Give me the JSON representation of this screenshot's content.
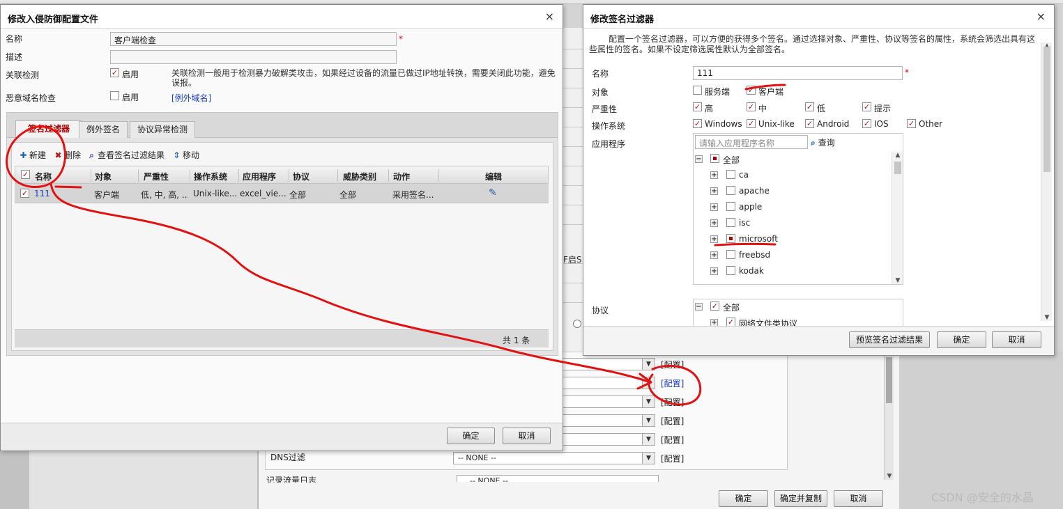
{
  "colors": {
    "annotation_red": "#e01212",
    "link_blue": "#1a3fb8",
    "tab_active_red": "#b00000"
  },
  "background": {
    "sidebar_snippet": "F启S",
    "config_rows": [
      {
        "value": "",
        "link": "[配置]",
        "highlight": false
      },
      {
        "value": "",
        "link": "[配置]",
        "highlight": true
      },
      {
        "value": "",
        "link": "[配置]",
        "highlight": false
      },
      {
        "value": "",
        "link": "[配置]",
        "highlight": false
      },
      {
        "value": "",
        "link": "[配置]",
        "highlight": false
      },
      {
        "value": "-- NONE --",
        "link": "[配置]",
        "highlight": false
      }
    ],
    "dns_label": "DNS过滤",
    "log_label": "记录流量日志",
    "log_value": "-- NONE --",
    "buttons": {
      "ok": "确定",
      "ok_copy": "确定并复制",
      "cancel": "取消"
    }
  },
  "dialog1": {
    "title": "修改入侵防御配置文件",
    "close": "×",
    "fields": {
      "name_label": "名称",
      "name_value": "客户端检查",
      "required_mark": "*",
      "desc_label": "描述",
      "desc_value": "",
      "assoc_label": "关联检测",
      "assoc_enable": "启用",
      "assoc_desc": "关联检测一般用于检测暴力破解类攻击，如果经过设备的流量已做过IP地址转换，需要关闭此功能，避免误报。",
      "malicious_label": "恶意域名检查",
      "malicious_enable": "启用",
      "exception_domain_link": "[例外域名]"
    },
    "tabs": [
      "签名过滤器",
      "例外签名",
      "协议异常检测"
    ],
    "toolbar": {
      "new": "新建",
      "delete": "删除",
      "view": "查看签名过滤结果",
      "move": "移动"
    },
    "grid": {
      "headers": [
        "名称",
        "对象",
        "严重性",
        "操作系统",
        "应用程序",
        "协议",
        "威胁类别",
        "动作",
        "编辑"
      ],
      "rows": [
        {
          "name": "111",
          "object": "客户端",
          "severity": "低, 中, 高, ...",
          "os": "Unix-like...",
          "app": "excel_vie...",
          "protocol": "全部",
          "threat": "全部",
          "action": "采用签名..."
        }
      ],
      "footer": "共 1 条"
    },
    "buttons": {
      "ok": "确定",
      "cancel": "取消"
    }
  },
  "dialog2": {
    "title": "修改签名过滤器",
    "close": "×",
    "intro": "配置一个签名过滤器，可以方便的获得多个签名。通过选择对象、严重性、协议等签名的属性，系统会筛选出具有这些属性的签名。如果不设定筛选属性默认为全部签名。",
    "name_label": "名称",
    "name_value": "111",
    "required_mark": "*",
    "object_label": "对象",
    "objects": [
      {
        "label": "服务端",
        "checked": false
      },
      {
        "label": "客户端",
        "checked": true
      }
    ],
    "severity_label": "严重性",
    "severities": [
      {
        "label": "高",
        "checked": true
      },
      {
        "label": "中",
        "checked": true
      },
      {
        "label": "低",
        "checked": true
      },
      {
        "label": "提示",
        "checked": true
      }
    ],
    "os_label": "操作系统",
    "os_list": [
      {
        "label": "Windows",
        "checked": true
      },
      {
        "label": "Unix-like",
        "checked": true
      },
      {
        "label": "Android",
        "checked": true
      },
      {
        "label": "IOS",
        "checked": true
      },
      {
        "label": "Other",
        "checked": true
      }
    ],
    "app_label": "应用程序",
    "app_search_placeholder": "请输入应用程序名称",
    "app_search_btn": "查询",
    "app_tree_root": "全部",
    "app_tree_items": [
      {
        "label": "ca",
        "state": "none"
      },
      {
        "label": "apache",
        "state": "none"
      },
      {
        "label": "apple",
        "state": "none"
      },
      {
        "label": "isc",
        "state": "none"
      },
      {
        "label": "microsoft",
        "state": "partial"
      },
      {
        "label": "freebsd",
        "state": "none"
      },
      {
        "label": "kodak",
        "state": "none"
      }
    ],
    "protocol_label": "协议",
    "protocol_root": "全部",
    "protocol_child": "网络文件类协议",
    "buttons": {
      "preview": "预览签名过滤结果",
      "ok": "确定",
      "cancel": "取消"
    }
  },
  "watermark": "CSDN @安全的水晶"
}
